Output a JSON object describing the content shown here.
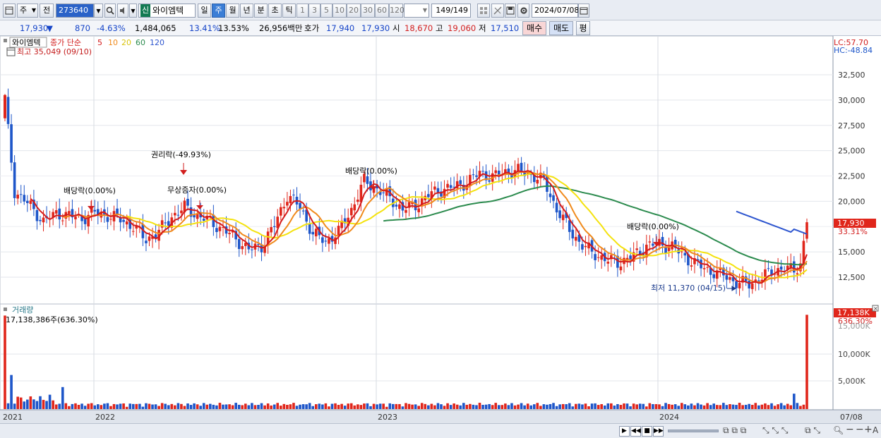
{
  "toolbar": {
    "interval_main": "주",
    "prev_label": "전",
    "code": "273640",
    "shin_badge": "신",
    "stock_name": "와이엠텍",
    "periods": [
      "일",
      "주",
      "월",
      "년",
      "분",
      "초",
      "틱"
    ],
    "period_selected": "주",
    "multipliers": [
      "1",
      "3",
      "5",
      "10",
      "20",
      "30",
      "60",
      "120"
    ],
    "page_count": "149/149",
    "date": "2024/07/08"
  },
  "quote": {
    "price": "17,930",
    "direction_arrow": "▼",
    "change": "870",
    "change_pct": "-4.63%",
    "volume": "1,484,065",
    "turnover_pct": "13.41%",
    "turnover2_pct": "13.53%",
    "amount": "26,956백만",
    "ask_label": "호가",
    "ask1": "17,940",
    "ask2": "17,930",
    "open_label": "시",
    "open": "18,670",
    "high_label": "고",
    "high": "19,060",
    "low_label": "저",
    "low": "17,510",
    "buy_label": "매수",
    "sell_label": "매도",
    "avg_label": "평"
  },
  "price_panel": {
    "stock_tag": "와이엠텍",
    "legend_type": "종가 단순",
    "ma": [
      {
        "period": "5",
        "color": "#d41b1b"
      },
      {
        "period": "10",
        "color": "#f08a1c"
      },
      {
        "period": "20",
        "color": "#f4e20e"
      },
      {
        "period": "60",
        "color": "#2c8b4e"
      },
      {
        "period": "120",
        "color": "#2d55cf"
      }
    ],
    "high_note": "최고 35,049 (09/10)",
    "low_note": "최저 11,370 (04/15)",
    "lc_label": "LC:57.70",
    "hc_label": "HC:-48.84",
    "y_ticks": [
      "32,500",
      "30,000",
      "27,500",
      "25,000",
      "22,500",
      "20,000",
      "15,000",
      "12,500"
    ],
    "current_price_tag": "17,930",
    "current_pct_tag": "33.31%",
    "annotations": [
      {
        "text": "배당락(0.00%)"
      },
      {
        "text": "권리락(-49.93%)"
      },
      {
        "text": "무상증자(0.00%)"
      },
      {
        "text": "배당락(0.00%)"
      },
      {
        "text": "배당락(0.00%)"
      }
    ]
  },
  "volume_panel": {
    "title": "거래량",
    "summary": "17,138,386주(636.30%)",
    "y_ticks": [
      "10,000K",
      "5,000K"
    ],
    "current_tag": "17,138K",
    "current_pct": "636.30%",
    "hidden_tick": "15,000K"
  },
  "x_axis": {
    "labels": [
      "2021",
      "2022",
      "2023",
      "2024"
    ],
    "right_label": "07/08"
  },
  "colors": {
    "up": "#e0261b",
    "down": "#1e56c9",
    "accent_blue": "#3b7ed6"
  },
  "chart_data": {
    "type": "candlestick",
    "title": "와이엠텍",
    "interval": "weekly",
    "ylim": [
      10000,
      36000
    ],
    "series_ma": [
      "5",
      "10",
      "20",
      "60",
      "120"
    ],
    "last": {
      "price": 17930,
      "open": 18670,
      "high": 19060,
      "low": 17510,
      "change": -870,
      "change_pct": -4.63
    },
    "volume_last": 17138386,
    "volume_last_pct": 636.3
  }
}
